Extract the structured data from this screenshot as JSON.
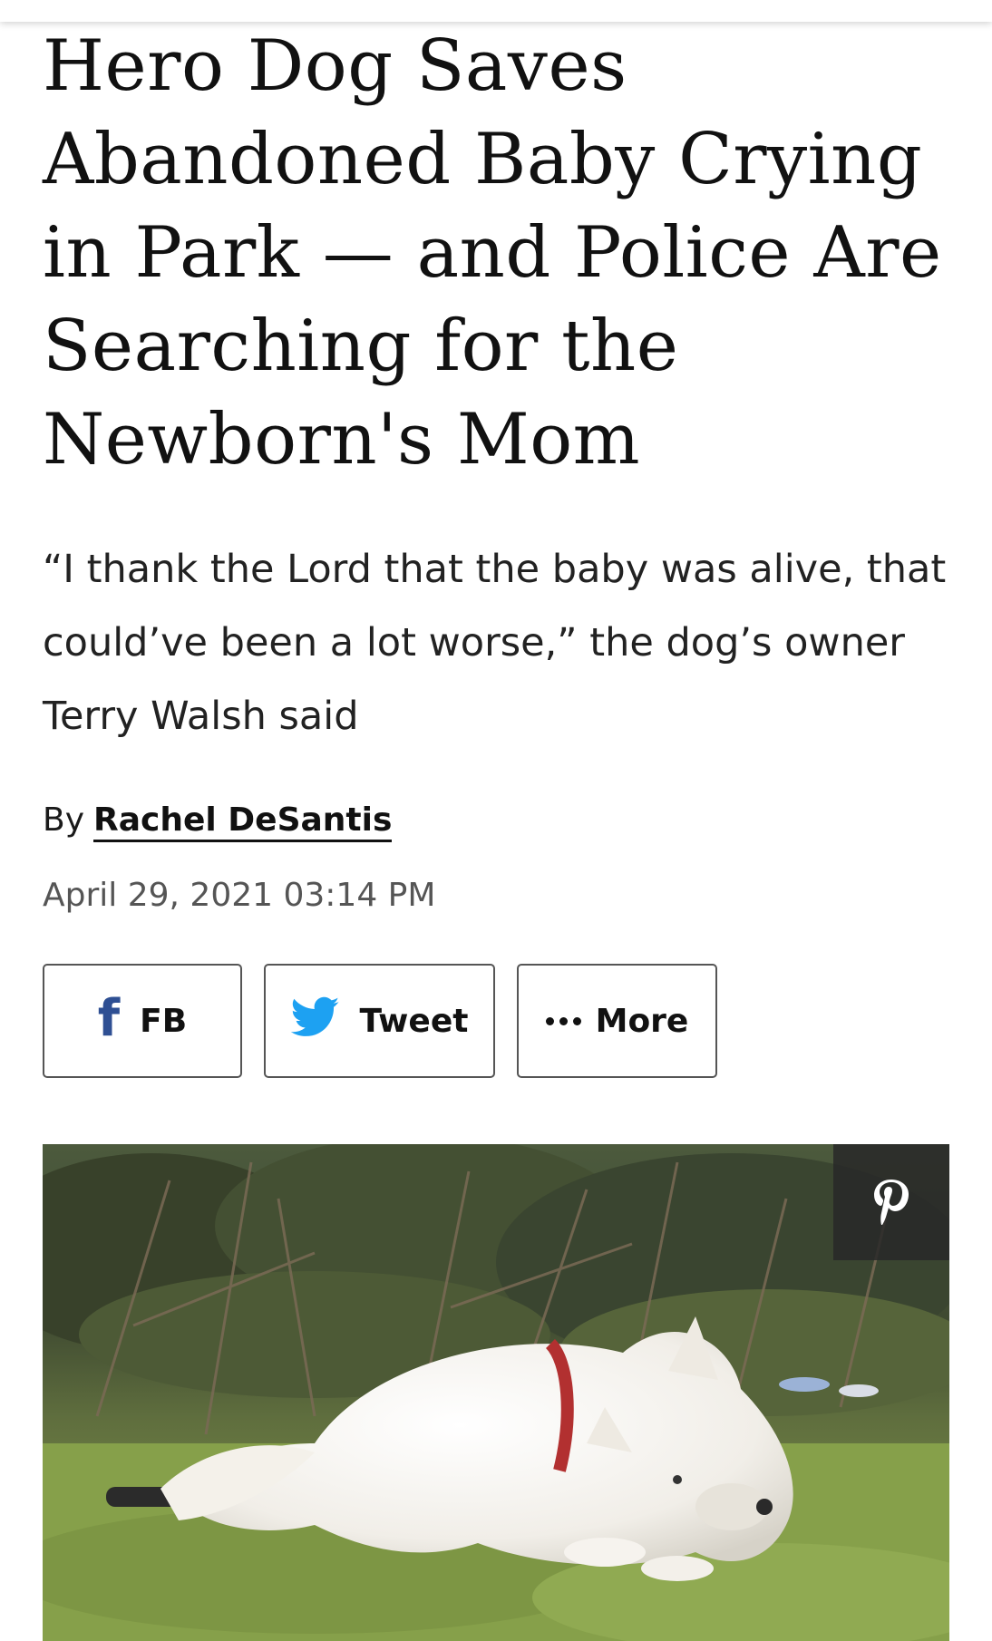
{
  "article": {
    "headline": "Hero Dog Saves Abandoned Baby Crying in Park — and Police Are Searching for the Newborn's Mom",
    "dek": "“I thank the Lord that the baby was alive, that could’ve been a lot worse,” the dog’s owner Terry Walsh said",
    "byline_prefix": "By",
    "author": "Rachel DeSantis",
    "date": "April 29, 2021 03:14 PM"
  },
  "share": {
    "fb_label": "FB",
    "tweet_label": "Tweet",
    "more_label": "More"
  },
  "icons": {
    "facebook": "facebook-icon",
    "twitter": "twitter-bird-icon",
    "more": "ellipsis-icon",
    "pinterest": "pinterest-icon"
  },
  "colors": {
    "facebook": "#2e4f93",
    "twitter": "#1da1f2",
    "pin_background": "#282828"
  }
}
